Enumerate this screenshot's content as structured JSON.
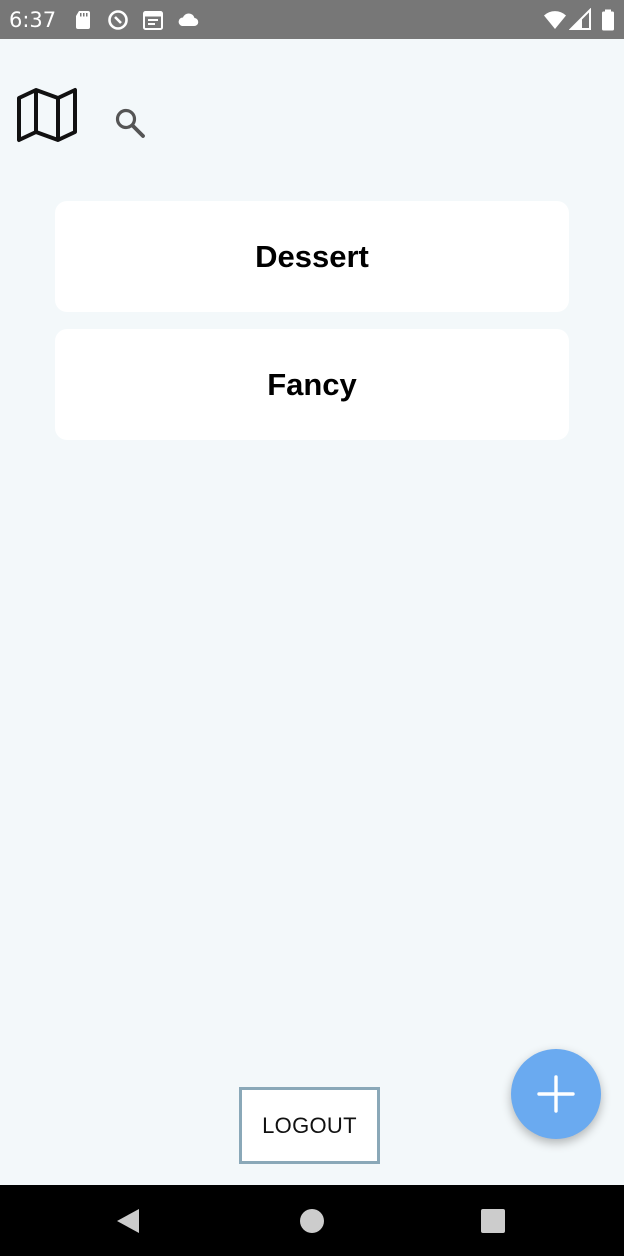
{
  "status_bar": {
    "time": "6:37",
    "left_icons": [
      "sd-card-icon",
      "data-saver-icon",
      "calendar-icon",
      "cloud-icon"
    ],
    "right_icons": [
      "wifi-icon",
      "signal-icon",
      "battery-icon"
    ]
  },
  "header": {
    "icons": [
      "map-icon",
      "search-icon"
    ]
  },
  "categories": [
    {
      "label": "Dessert"
    },
    {
      "label": "Fancy"
    }
  ],
  "actions": {
    "logout_label": "LOGOUT",
    "fab_icon": "plus-icon"
  },
  "nav_bar": {
    "icons": [
      "back-icon",
      "home-icon",
      "recents-icon"
    ]
  },
  "colors": {
    "background": "#f3f8fa",
    "status_bar": "#777777",
    "fab": "#6aaaf0",
    "logout_border": "#8aa8b8",
    "nav_bar": "#000000"
  }
}
